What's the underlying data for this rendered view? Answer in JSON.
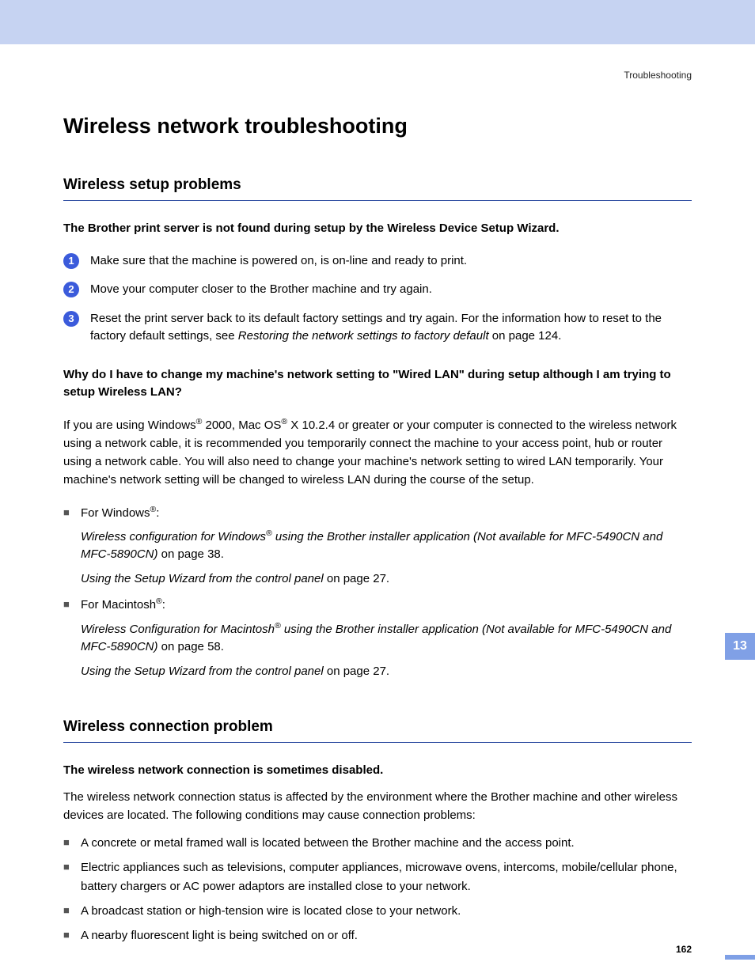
{
  "header": {
    "note": "Troubleshooting"
  },
  "title": "Wireless network troubleshooting",
  "section1": {
    "heading": "Wireless setup problems",
    "boldIntro": "The Brother print server is not found during setup by the Wireless Device Setup Wizard.",
    "step1": "Make sure that the machine is powered on, is on-line and ready to print.",
    "step2": "Move your computer closer to the Brother machine and try again.",
    "step3_a": "Reset the print server back to its default factory settings and try again. For the information how to reset to the factory default settings, see ",
    "step3_link": "Restoring the network settings to factory default",
    "step3_b": " on page 124.",
    "boldQ": "Why do I have to change my machine's network setting to \"Wired LAN\" during setup although I am trying to setup Wireless LAN?",
    "para_a": "If you are using Windows",
    "para_b": " 2000, Mac OS",
    "para_c": " X 10.2.4 or greater or your computer is connected to the wireless network using a network cable, it is recommended you temporarily connect the machine to your access point, hub or router using a network cable. You will also need to change your machine's network setting to wired LAN temporarily. Your machine's network setting will be changed to wireless LAN during the course of the setup.",
    "win_label_a": "For Windows",
    "win_label_b": ":",
    "win_sub1_a": "Wireless configuration for Windows",
    "win_sub1_b": " using the Brother installer application (Not available for MFC-5490CN and MFC-5890CN)",
    "win_sub1_c": " on page 38.",
    "win_sub2_a": "Using the Setup Wizard from the control panel",
    "win_sub2_b": " on page 27.",
    "mac_label_a": "For Macintosh",
    "mac_label_b": ":",
    "mac_sub1_a": "Wireless Configuration for Macintosh",
    "mac_sub1_b": " using the Brother installer application (Not available for MFC-5490CN and MFC-5890CN)",
    "mac_sub1_c": " on page 58.",
    "mac_sub2_a": "Using the Setup Wizard from the control panel",
    "mac_sub2_b": " on page 27."
  },
  "section2": {
    "heading": "Wireless connection problem",
    "boldIntro": "The wireless network connection is sometimes disabled.",
    "para": "The wireless network connection status is affected by the environment where the Brother machine and other wireless devices are located. The following conditions may cause connection problems:",
    "b1": "A concrete or metal framed wall is located between the Brother machine and the access point.",
    "b2": "Electric appliances such as televisions, computer appliances, microwave ovens, intercoms, mobile/cellular phone, battery chargers or AC power adaptors are installed close to your network.",
    "b3": "A broadcast station or high-tension wire is located close to your network.",
    "b4": "A nearby fluorescent light is being switched on or off."
  },
  "sideTab": "13",
  "pageNumber": "162",
  "reg": "®"
}
